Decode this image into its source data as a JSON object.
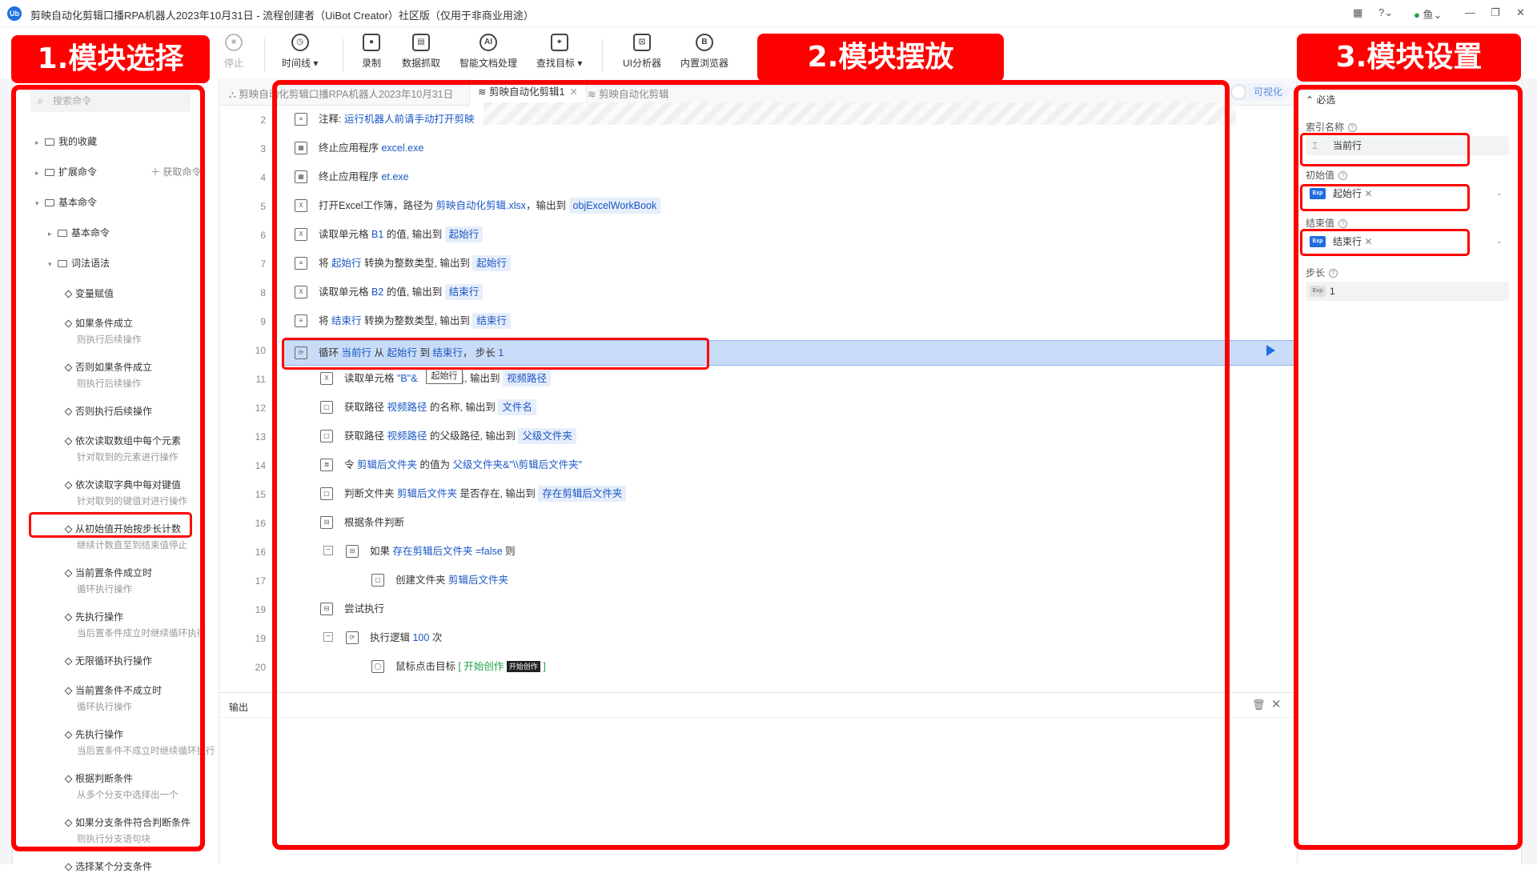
{
  "window": {
    "title": "剪映自动化剪辑口播RPA机器人2023年10月31日 - 流程创建者（UiBot Creator）社区版（仅用于非商业用途）",
    "logo": "Ub",
    "user": "鱼"
  },
  "toolbar": {
    "stop": "停止",
    "timeline": "时间线",
    "record": "录制",
    "data_scrape": "数据抓取",
    "smart_doc": "智能文档处理",
    "find_target": "查找目标",
    "ui_analyzer": "UI分析器",
    "browser": "内置浏览器"
  },
  "left": {
    "search_placeholder": "搜索命令",
    "favorites": "我的收藏",
    "extensions": "扩展命令",
    "get_command": "获取命令",
    "basic": "基本命令",
    "basic_sub": "基本命令",
    "syntax": "词法语法",
    "items": [
      {
        "label": "变量赋值",
        "desc": ""
      },
      {
        "label": "如果条件成立",
        "desc": "则执行后续操作"
      },
      {
        "label": "否则如果条件成立",
        "desc": "则执行后续操作"
      },
      {
        "label": "否则执行后续操作",
        "desc": ""
      },
      {
        "label": "依次读取数组中每个元素",
        "desc": "针对取到的元素进行操作"
      },
      {
        "label": "依次读取字典中每对键值",
        "desc": "针对取到的键值对进行操作"
      },
      {
        "label": "从初始值开始按步长计数",
        "desc": "继续计数直至到结束值停止"
      },
      {
        "label": "当前置条件成立时",
        "desc": "循环执行操作"
      },
      {
        "label": "先执行操作",
        "desc": "当后置条件成立时继续循环执行"
      },
      {
        "label": "无限循环执行操作",
        "desc": ""
      },
      {
        "label": "当前置条件不成立时",
        "desc": "循环执行操作"
      },
      {
        "label": "先执行操作",
        "desc": "当后置条件不成立时继续循环执行"
      },
      {
        "label": "根据判断条件",
        "desc": "从多个分支中选择出一个"
      },
      {
        "label": "如果分支条件符合判断条件",
        "desc": "则执行分支语句块"
      },
      {
        "label": "选择某个分支条件",
        "desc": ""
      }
    ]
  },
  "tabs": {
    "t1": "剪映自动化剪辑口播RPA机器人2023年10月31日",
    "t2": "剪映自动化剪辑1",
    "t3": "剪映自动化剪辑",
    "visual": "可视化"
  },
  "code": {
    "r2": {
      "ln": "2",
      "a": "注释: ",
      "b": "运行机器人前请手动打开剪映"
    },
    "r3": {
      "ln": "3",
      "a": "终止应用程序 ",
      "b": "excel.exe"
    },
    "r4": {
      "ln": "4",
      "a": "终止应用程序 ",
      "b": "et.exe"
    },
    "r5": {
      "ln": "5",
      "a": "打开Excel工作簿，路径为 ",
      "b": "剪映自动化剪辑.xlsx",
      "c": "，输出到 ",
      "d": "objExcelWorkBook"
    },
    "r6": {
      "ln": "6",
      "a": "读取单元格 ",
      "b": "B1",
      "c": " 的值, 输出到 ",
      "d": "起始行"
    },
    "r7": {
      "ln": "7",
      "a": "将 ",
      "b": "起始行",
      "c": " 转换为整数类型, 输出到 ",
      "d": "起始行"
    },
    "r8": {
      "ln": "8",
      "a": "读取单元格 ",
      "b": "B2",
      "c": " 的值, 输出到 ",
      "d": "结束行"
    },
    "r9": {
      "ln": "9",
      "a": "将 ",
      "b": "结束行",
      "c": " 转换为整数类型, 输出到 ",
      "d": "结束行"
    },
    "r10": {
      "ln": "10",
      "a": "循环 ",
      "b": "当前行",
      "c": " 从 ",
      "d": "起始行",
      "e": " 到 ",
      "f": "结束行",
      "g": "， 步长 ",
      "h": "1"
    },
    "r11": {
      "ln": "11",
      "a": "读取单元格 ",
      "b": "\"B\"&",
      "c": "值, 输出到 ",
      "d": "视频路径"
    },
    "r12": {
      "ln": "12",
      "a": "获取路径 ",
      "b": "视频路径",
      "c": " 的名称, 输出到 ",
      "d": "文件名"
    },
    "r13": {
      "ln": "13",
      "a": "获取路径 ",
      "b": "视频路径",
      "c": " 的父级路径, 输出到 ",
      "d": "父级文件夹"
    },
    "r14": {
      "ln": "14",
      "a": "令 ",
      "b": "剪辑后文件夹",
      "c": " 的值为 ",
      "d": "父级文件夹&\"\\\\剪辑后文件夹\""
    },
    "r15": {
      "ln": "15",
      "a": "判断文件夹 ",
      "b": "剪辑后文件夹",
      "c": " 是否存在, 输出到 ",
      "d": "存在剪辑后文件夹"
    },
    "r16a": {
      "ln": "16",
      "a": "根据条件判断"
    },
    "r16b": {
      "ln": "16",
      "a": "如果 ",
      "b": "存在剪辑后文件夹",
      "c": " =false",
      "d": " 则"
    },
    "r17": {
      "ln": "17",
      "a": "创建文件夹 ",
      "b": "剪辑后文件夹"
    },
    "r19a": {
      "ln": "19",
      "a": "尝试执行"
    },
    "r19b": {
      "ln": "19",
      "a": "执行逻辑 ",
      "b": "100",
      "c": " 次"
    },
    "r20": {
      "ln": "20",
      "a": "鼠标点击目标 ",
      "b": "[ 开始创作 ",
      "c": "开始创作",
      "d": " ]"
    },
    "tooltip": "起始行"
  },
  "output": {
    "label": "输出"
  },
  "right": {
    "required": "必选",
    "index_label": "索引名称",
    "index_value": "当前行",
    "start_label": "初始值",
    "start_value": "起始行",
    "end_label": "结束值",
    "end_value": "结束行",
    "step_label": "步长",
    "step_value": "1",
    "exp": "Exp"
  },
  "annotations": {
    "a1": "1.模块选择",
    "a2": "2.模块摆放",
    "a3": "3.模块设置"
  }
}
